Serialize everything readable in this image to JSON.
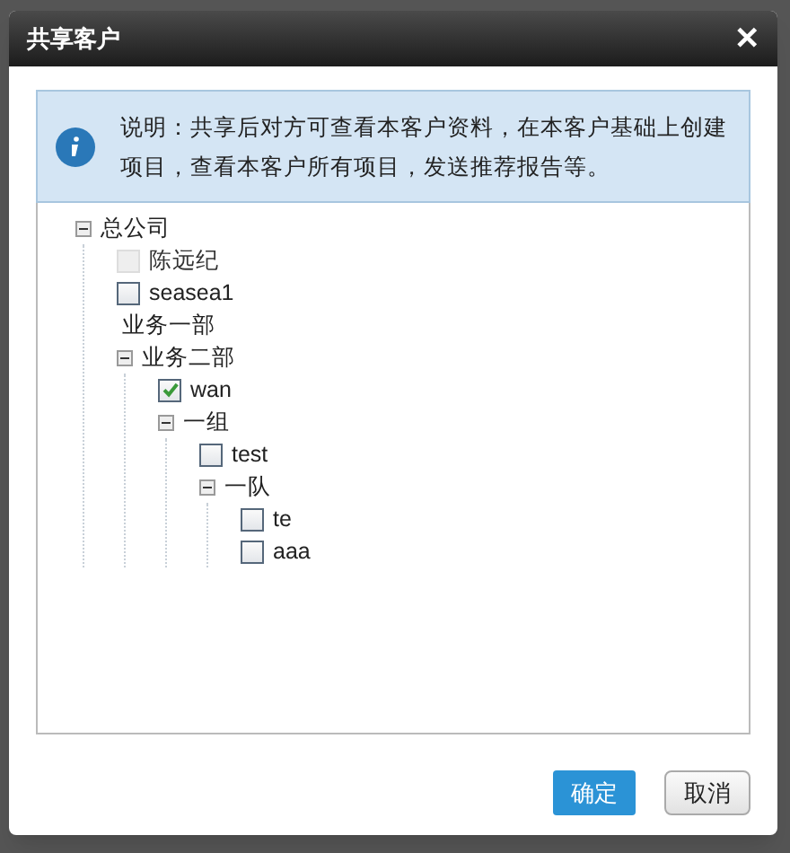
{
  "dialog": {
    "title": "共享客户",
    "close": "✕"
  },
  "notice": {
    "text": "说明：共享后对方可查看本客户资料，在本客户基础上创建项目，查看本客户所有项目，发送推荐报告等。"
  },
  "tree": [
    {
      "label": "总公司",
      "kind": "group",
      "expanded": true,
      "children": [
        {
          "label": "陈远纪",
          "kind": "user",
          "checked": false,
          "disabled": true
        },
        {
          "label": "seasea1",
          "kind": "user",
          "checked": false,
          "disabled": false
        },
        {
          "label": "业务一部",
          "kind": "group"
        },
        {
          "label": "业务二部",
          "kind": "group",
          "expanded": true,
          "children": [
            {
              "label": "wan",
              "kind": "user",
              "checked": true,
              "disabled": false
            },
            {
              "label": "一组",
              "kind": "group",
              "expanded": true,
              "children": [
                {
                  "label": "test",
                  "kind": "user",
                  "checked": false,
                  "disabled": false
                },
                {
                  "label": "一队",
                  "kind": "group",
                  "expanded": true,
                  "children": [
                    {
                      "label": "te",
                      "kind": "user",
                      "checked": false,
                      "disabled": false
                    },
                    {
                      "label": "aaa",
                      "kind": "user",
                      "checked": false,
                      "disabled": false
                    }
                  ]
                }
              ]
            }
          ]
        }
      ]
    }
  ],
  "buttons": [
    {
      "label": "确定",
      "kind": "primary"
    },
    {
      "label": "取消",
      "kind": "secondary"
    }
  ]
}
